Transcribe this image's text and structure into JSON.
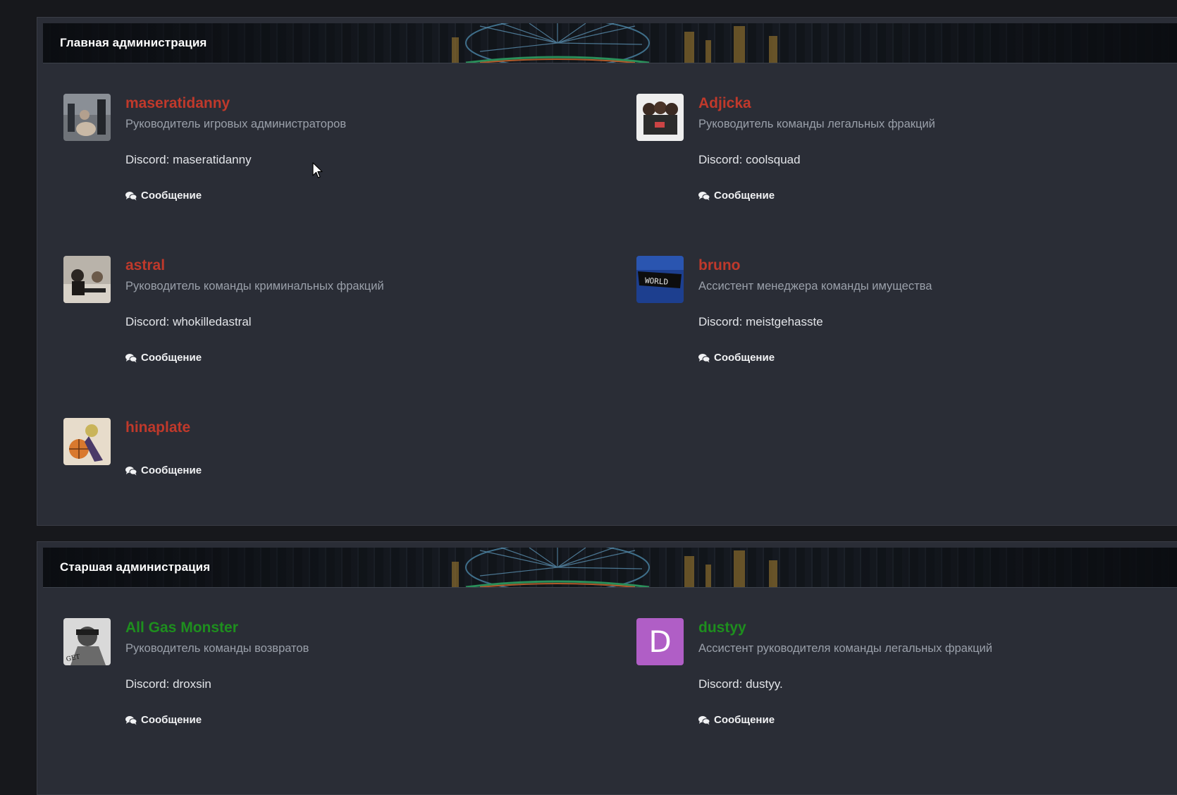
{
  "sections": [
    {
      "title": "Главная администрация",
      "members": [
        {
          "name": "maseratidanny",
          "role": "Руководитель игровых администраторов",
          "discord": "Discord: maseratidanny",
          "message": "Сообщение",
          "name_color": "#c0392b"
        },
        {
          "name": "Adjicka",
          "role": "Руководитель команды легальных фракций",
          "discord": "Discord: coolsquad",
          "message": "Сообщение",
          "name_color": "#c0392b"
        },
        {
          "name": "astral",
          "role": "Руководитель команды криминальных фракций",
          "discord": "Discord: whokilledastral",
          "message": "Сообщение",
          "name_color": "#c0392b"
        },
        {
          "name": "bruno",
          "role": "Ассистент менеджера команды имущества",
          "discord": "Discord: meistgehasste",
          "message": "Сообщение",
          "name_color": "#c0392b"
        },
        {
          "name": "hinaplate",
          "message": "Сообщение",
          "name_color": "#c0392b"
        }
      ]
    },
    {
      "title": "Старшая администрация",
      "members": [
        {
          "name": "All Gas Monster",
          "role": "Руководитель команды возвратов",
          "discord": "Discord: droxsin",
          "message": "Сообщение",
          "name_color": "#1e8f1e"
        },
        {
          "name": "dustyy",
          "role": "Ассистент руководителя команды легальных фракций",
          "discord": "Discord: dustyy.",
          "message": "Сообщение",
          "name_color": "#1e8f1e",
          "avatar_letter": "D",
          "avatar_color": "#b05ec6"
        }
      ]
    }
  ],
  "icons": {
    "message": "comments-icon"
  }
}
